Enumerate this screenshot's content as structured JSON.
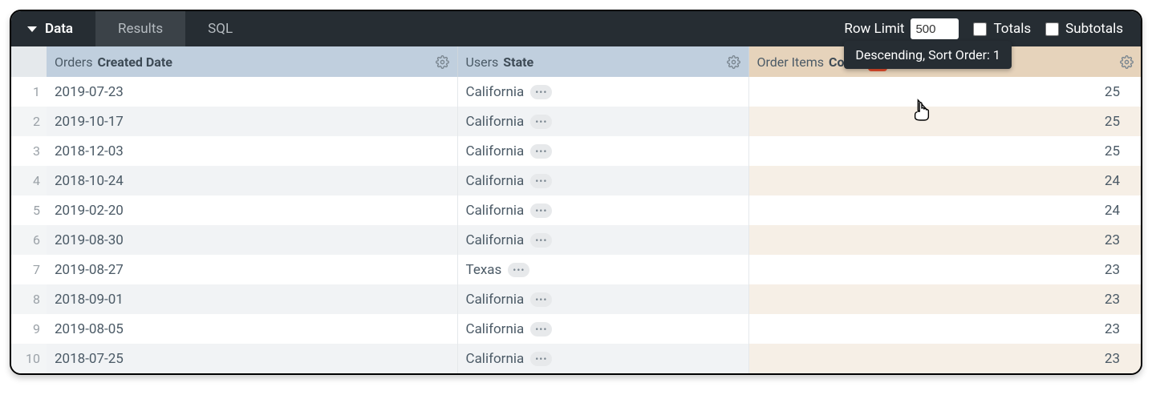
{
  "tabs": {
    "data": "Data",
    "results": "Results",
    "sql": "SQL"
  },
  "controls": {
    "row_limit_label": "Row Limit",
    "row_limit_value": "500",
    "totals_label": "Totals",
    "subtotals_label": "Subtotals",
    "tooltip": "Descending, Sort Order: 1"
  },
  "columns": {
    "orders_prefix": "Orders ",
    "orders_field": "Created Date",
    "users_prefix": "Users ",
    "users_field": "State",
    "items_prefix": "Order Items ",
    "items_field": "Count"
  },
  "rows": [
    {
      "n": "1",
      "date": "2019-07-23",
      "state": "California",
      "count": "25"
    },
    {
      "n": "2",
      "date": "2019-10-17",
      "state": "California",
      "count": "25"
    },
    {
      "n": "3",
      "date": "2018-12-03",
      "state": "California",
      "count": "25"
    },
    {
      "n": "4",
      "date": "2018-10-24",
      "state": "California",
      "count": "24"
    },
    {
      "n": "5",
      "date": "2019-02-20",
      "state": "California",
      "count": "24"
    },
    {
      "n": "6",
      "date": "2019-08-30",
      "state": "California",
      "count": "23"
    },
    {
      "n": "7",
      "date": "2019-08-27",
      "state": "Texas",
      "count": "23"
    },
    {
      "n": "8",
      "date": "2018-09-01",
      "state": "California",
      "count": "23"
    },
    {
      "n": "9",
      "date": "2019-08-05",
      "state": "California",
      "count": "23"
    },
    {
      "n": "10",
      "date": "2018-07-25",
      "state": "California",
      "count": "23"
    }
  ]
}
